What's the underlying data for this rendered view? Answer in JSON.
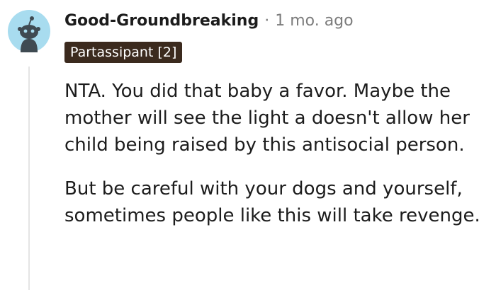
{
  "comment": {
    "username": "Good-Groundbreaking",
    "separator": "·",
    "timestamp": "1 mo. ago",
    "flair": "Partassipant [2]",
    "paragraphs": [
      "NTA. You did that baby a favor. Maybe the mother will see the light a doesn't allow her child being raised by this antisocial person.",
      "But be careful with your dogs and yourself, sometimes people like this will take revenge."
    ],
    "colors": {
      "avatar_bg": "#a8dcef",
      "avatar_figure": "#3f4a52",
      "flair_bg": "#3b2a1e",
      "thread_line": "#e5e5e5"
    },
    "icons": {
      "avatar": "snoo-avatar-icon"
    }
  }
}
